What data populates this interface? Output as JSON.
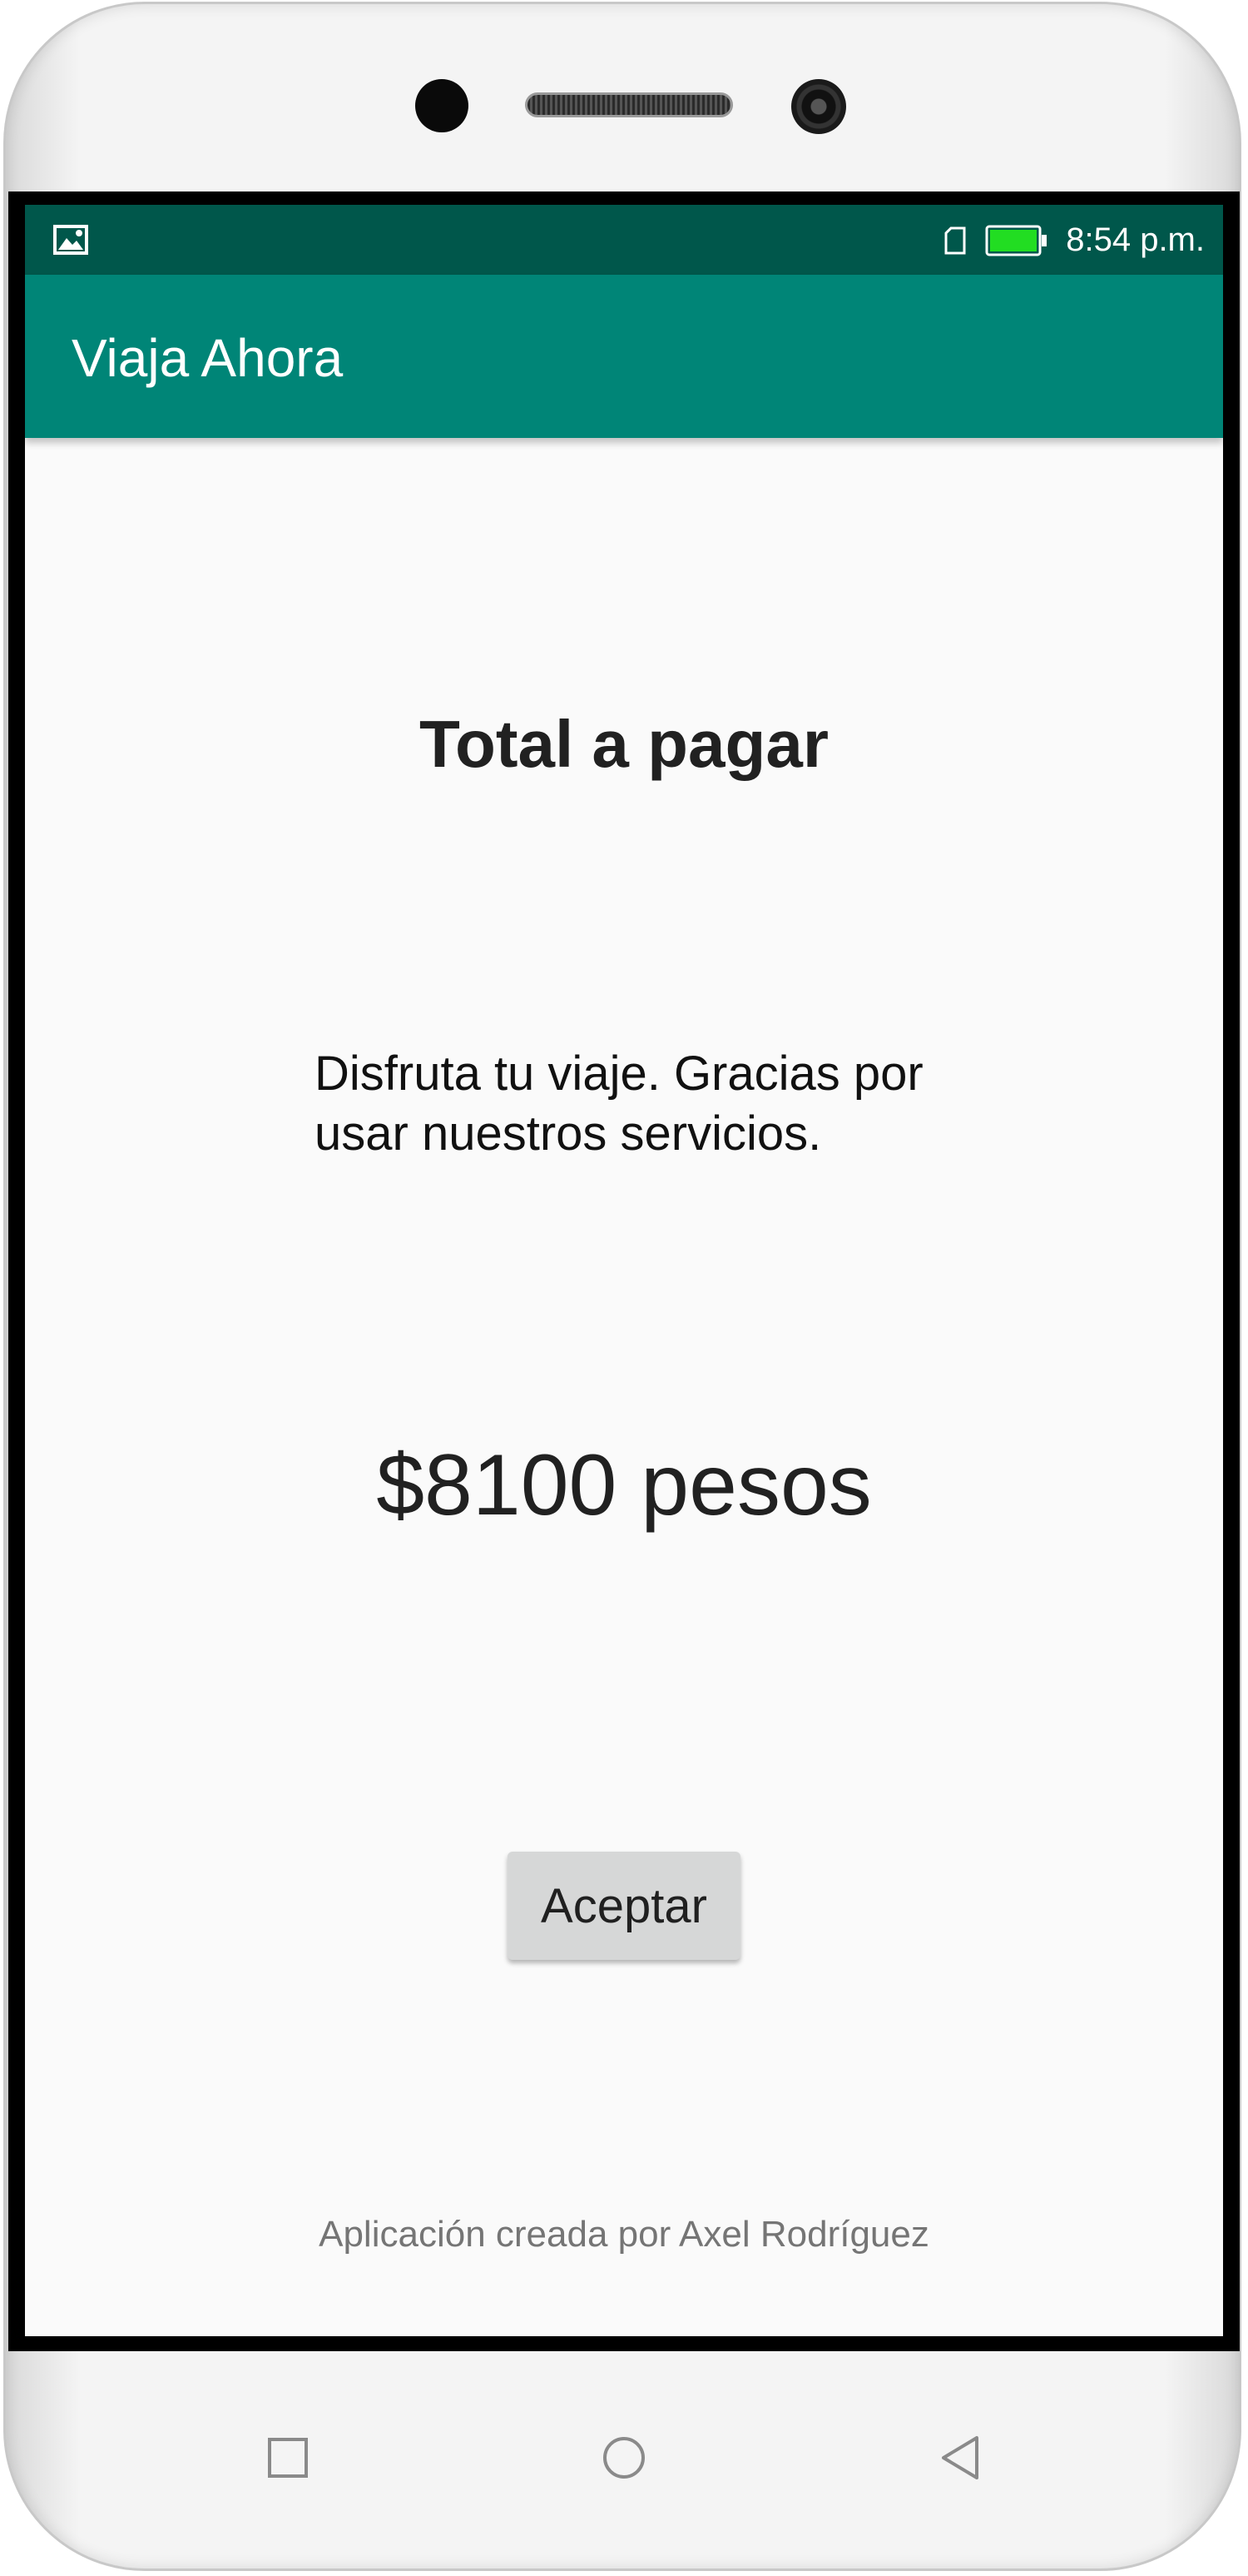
{
  "status_bar": {
    "time": "8:54 p.m.",
    "icons": [
      "image-notification-icon",
      "sim-card-icon",
      "battery-icon"
    ],
    "battery_color": "#22dd22"
  },
  "app_bar": {
    "title": "Viaja Ahora",
    "color": "#008577"
  },
  "content": {
    "title": "Total a pagar",
    "message": "Disfruta tu viaje. Gracias por usar nuestros servicios.",
    "amount": "$8100 pesos",
    "accept_button_label": "Aceptar",
    "footer": "Aplicación creada por Axel Rodríguez"
  },
  "navigation": {
    "keys": [
      "recent-apps-icon",
      "home-icon",
      "back-icon"
    ]
  }
}
